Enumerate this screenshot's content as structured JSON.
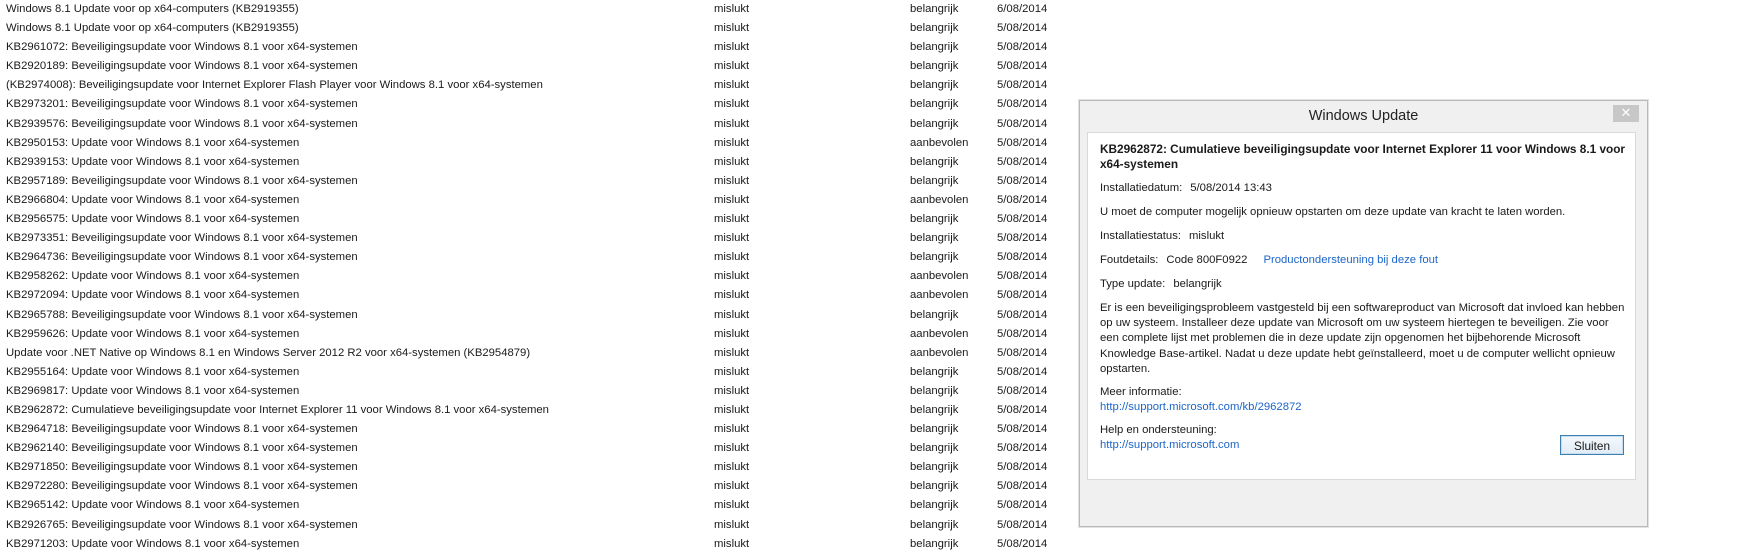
{
  "updates": [
    {
      "name": "Windows 8.1 Update voor op x64-computers (KB2919355)",
      "status": "mislukt",
      "importance": "belangrijk",
      "date": "6/08/2014"
    },
    {
      "name": "Windows 8.1 Update voor op x64-computers (KB2919355)",
      "status": "mislukt",
      "importance": "belangrijk",
      "date": "5/08/2014"
    },
    {
      "name": "KB2961072: Beveiligingsupdate voor Windows 8.1 voor x64-systemen",
      "status": "mislukt",
      "importance": "belangrijk",
      "date": "5/08/2014"
    },
    {
      "name": "KB2920189: Beveiligingsupdate voor Windows 8.1 voor x64-systemen",
      "status": "mislukt",
      "importance": "belangrijk",
      "date": "5/08/2014"
    },
    {
      "name": "(KB2974008): Beveiligingsupdate voor Internet Explorer Flash Player voor Windows 8.1 voor x64-systemen",
      "status": "mislukt",
      "importance": "belangrijk",
      "date": "5/08/2014"
    },
    {
      "name": "KB2973201: Beveiligingsupdate voor Windows 8.1 voor x64-systemen",
      "status": "mislukt",
      "importance": "belangrijk",
      "date": "5/08/2014"
    },
    {
      "name": "KB2939576: Beveiligingsupdate voor Windows 8.1 voor x64-systemen",
      "status": "mislukt",
      "importance": "belangrijk",
      "date": "5/08/2014"
    },
    {
      "name": "KB2950153: Update voor Windows 8.1 voor x64-systemen",
      "status": "mislukt",
      "importance": "aanbevolen",
      "date": "5/08/2014"
    },
    {
      "name": "KB2939153: Update voor Windows 8.1 voor x64-systemen",
      "status": "mislukt",
      "importance": "belangrijk",
      "date": "5/08/2014"
    },
    {
      "name": "KB2957189: Beveiligingsupdate voor Windows 8.1 voor x64-systemen",
      "status": "mislukt",
      "importance": "belangrijk",
      "date": "5/08/2014"
    },
    {
      "name": "KB2966804: Update voor Windows 8.1 voor x64-systemen",
      "status": "mislukt",
      "importance": "aanbevolen",
      "date": "5/08/2014"
    },
    {
      "name": "KB2956575: Update voor Windows 8.1 voor x64-systemen",
      "status": "mislukt",
      "importance": "belangrijk",
      "date": "5/08/2014"
    },
    {
      "name": "KB2973351: Beveiligingsupdate voor Windows 8.1 voor x64-systemen",
      "status": "mislukt",
      "importance": "belangrijk",
      "date": "5/08/2014"
    },
    {
      "name": "KB2964736: Beveiligingsupdate voor Windows 8.1 voor x64-systemen",
      "status": "mislukt",
      "importance": "belangrijk",
      "date": "5/08/2014"
    },
    {
      "name": "KB2958262: Update voor Windows 8.1 voor x64-systemen",
      "status": "mislukt",
      "importance": "aanbevolen",
      "date": "5/08/2014"
    },
    {
      "name": "KB2972094: Update voor Windows 8.1 voor x64-systemen",
      "status": "mislukt",
      "importance": "aanbevolen",
      "date": "5/08/2014"
    },
    {
      "name": "KB2965788: Beveiligingsupdate voor Windows 8.1 voor x64-systemen",
      "status": "mislukt",
      "importance": "belangrijk",
      "date": "5/08/2014"
    },
    {
      "name": "KB2959626: Update voor Windows 8.1 voor x64-systemen",
      "status": "mislukt",
      "importance": "aanbevolen",
      "date": "5/08/2014"
    },
    {
      "name": "Update voor .NET Native op Windows 8.1 en Windows Server 2012 R2 voor x64-systemen (KB2954879)",
      "status": "mislukt",
      "importance": "aanbevolen",
      "date": "5/08/2014"
    },
    {
      "name": "KB2955164: Update voor Windows 8.1 voor x64-systemen",
      "status": "mislukt",
      "importance": "belangrijk",
      "date": "5/08/2014"
    },
    {
      "name": "KB2969817: Update voor Windows 8.1 voor x64-systemen",
      "status": "mislukt",
      "importance": "belangrijk",
      "date": "5/08/2014"
    },
    {
      "name": "KB2962872: Cumulatieve beveiligingsupdate voor Internet Explorer 11 voor Windows 8.1 voor x64-systemen",
      "status": "mislukt",
      "importance": "belangrijk",
      "date": "5/08/2014"
    },
    {
      "name": "KB2964718: Beveiligingsupdate voor Windows 8.1 voor x64-systemen",
      "status": "mislukt",
      "importance": "belangrijk",
      "date": "5/08/2014"
    },
    {
      "name": "KB2962140: Beveiligingsupdate voor Windows 8.1 voor x64-systemen",
      "status": "mislukt",
      "importance": "belangrijk",
      "date": "5/08/2014"
    },
    {
      "name": "KB2971850: Beveiligingsupdate voor Windows 8.1 voor x64-systemen",
      "status": "mislukt",
      "importance": "belangrijk",
      "date": "5/08/2014"
    },
    {
      "name": "KB2972280: Beveiligingsupdate voor Windows 8.1 voor x64-systemen",
      "status": "mislukt",
      "importance": "belangrijk",
      "date": "5/08/2014"
    },
    {
      "name": "KB2965142: Update voor Windows 8.1 voor x64-systemen",
      "status": "mislukt",
      "importance": "belangrijk",
      "date": "5/08/2014"
    },
    {
      "name": "KB2926765: Beveiligingsupdate voor Windows 8.1 voor x64-systemen",
      "status": "mislukt",
      "importance": "belangrijk",
      "date": "5/08/2014"
    },
    {
      "name": "KB2971203: Update voor Windows 8.1 voor x64-systemen",
      "status": "mislukt",
      "importance": "belangrijk",
      "date": "5/08/2014"
    }
  ],
  "dialog": {
    "title": "Windows Update",
    "close_icon": "close-icon",
    "close_glyph": "✕",
    "heading": "KB2962872: Cumulatieve beveiligingsupdate voor Internet Explorer 11 voor Windows 8.1 voor x64-systemen",
    "install_date_label": "Installatiedatum:",
    "install_date_value": "5/08/2014 13:43",
    "restart_note": "U moet de computer mogelijk opnieuw opstarten om deze update van kracht te laten worden.",
    "install_status_label": "Installatiestatus:",
    "install_status_value": "mislukt",
    "error_details_label": "Foutdetails:",
    "error_details_value": "Code 800F0922",
    "error_support_link": "Productondersteuning bij deze fout",
    "update_type_label": "Type update:",
    "update_type_value": "belangrijk",
    "description": "Er is een beveiligingsprobleem vastgesteld bij een softwareproduct van Microsoft dat invloed kan hebben op uw systeem. Installeer deze update van Microsoft om uw systeem hiertegen te beveiligen. Zie voor een complete lijst met problemen die in deze update zijn opgenomen het bijbehorende Microsoft Knowledge Base-artikel. Nadat u deze update hebt geïnstalleerd, moet u de computer wellicht opnieuw opstarten.",
    "more_info_label": "Meer informatie:",
    "more_info_link": "http://support.microsoft.com/kb/2962872",
    "help_label": "Help en ondersteuning:",
    "help_link": "http://support.microsoft.com",
    "close_button_label": "Sluiten"
  },
  "colors": {
    "link": "#1c66c9",
    "dialog_background": "#f0f0f0",
    "button_border": "#3c7fb1"
  }
}
